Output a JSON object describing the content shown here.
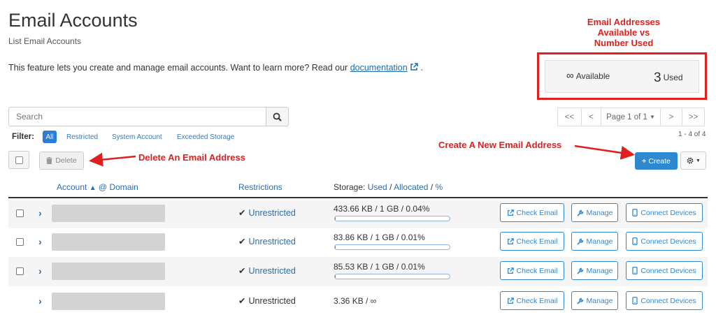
{
  "header": {
    "title": "Email Accounts",
    "breadcrumb": "List Email Accounts",
    "intro_text": "This feature lets you create and manage email accounts. Want to learn more? Read our ",
    "doc_link": "documentation",
    "intro_end": "."
  },
  "stats": {
    "available_symbol": "∞",
    "available_label": "Available",
    "used_count": "3",
    "used_label": "Used"
  },
  "annotations": {
    "stats_line1": "Email Addresses",
    "stats_line2": "Available vs",
    "stats_line3": "Number Used",
    "delete": "Delete An Email Address",
    "create": "Create A New Email Address",
    "color": "#e02020"
  },
  "search": {
    "placeholder": "Search"
  },
  "pagination": {
    "first": "<<",
    "prev": "<",
    "page": "Page 1 of 1",
    "next": ">",
    "last": ">>",
    "range": "1 - 4 of 4"
  },
  "filter": {
    "label": "Filter:",
    "all": "All",
    "restricted": "Restricted",
    "system": "System Account",
    "exceeded": "Exceeded Storage"
  },
  "actions": {
    "delete": "Delete",
    "create": "Create",
    "accent": "#2e88d0"
  },
  "table": {
    "col_account": "Account",
    "col_domain": "@ Domain",
    "col_restrictions": "Restrictions",
    "col_storage": "Storage:",
    "col_used": "Used",
    "col_allocated": "Allocated",
    "col_pct": "%",
    "slash": "/",
    "rows": [
      {
        "restriction": "Unrestricted",
        "storage": "433.66 KB / 1 GB / 0.04%",
        "usage_fraction": 0.0004
      },
      {
        "restriction": "Unrestricted",
        "storage": "83.86 KB / 1 GB / 0.01%",
        "usage_fraction": 0.0001
      },
      {
        "restriction": "Unrestricted",
        "storage": "85.53 KB / 1 GB / 0.01%",
        "usage_fraction": 0.0001
      },
      {
        "restriction": "Unrestricted",
        "storage": "3.36 KB / ∞"
      }
    ],
    "btn_check": "Check Email",
    "btn_manage": "Manage",
    "btn_devices": "Connect Devices"
  }
}
